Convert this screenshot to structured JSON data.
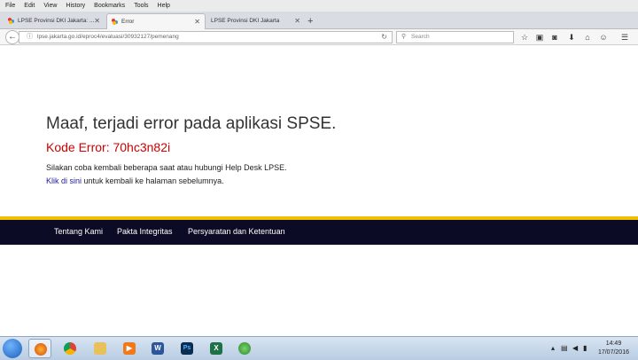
{
  "menu": [
    "File",
    "Edit",
    "View",
    "History",
    "Bookmarks",
    "Tools",
    "Help"
  ],
  "tabs": [
    {
      "label": "LPSE Provinsi DKI Jakarta: ..."
    },
    {
      "label": "Error"
    },
    {
      "label": "LPSE Provinsi DKI Jakarta"
    }
  ],
  "url": "lpse.jakarta.go.id/eproc4/evaluasi/30932127/pemenang",
  "search_placeholder": "Search",
  "error": {
    "title": "Maaf, terjadi error pada aplikasi SPSE.",
    "code": "Kode Error: 70hc3n82i",
    "message": "Silakan coba kembali beberapa saat atau hubungi Help Desk LPSE.",
    "link_text": "Klik di sini",
    "link_suffix": " untuk kembali ke halaman sebelumnya."
  },
  "footer": [
    "Tentang Kami",
    "Pakta Integritas",
    "Persyaratan dan Ketentuan"
  ],
  "clock": {
    "time": "14:49",
    "date": "17/07/2016"
  },
  "colors": {
    "error_code": "#cc0000",
    "footer_bg": "#0b0b25",
    "accent_bar": "#f0c000"
  }
}
